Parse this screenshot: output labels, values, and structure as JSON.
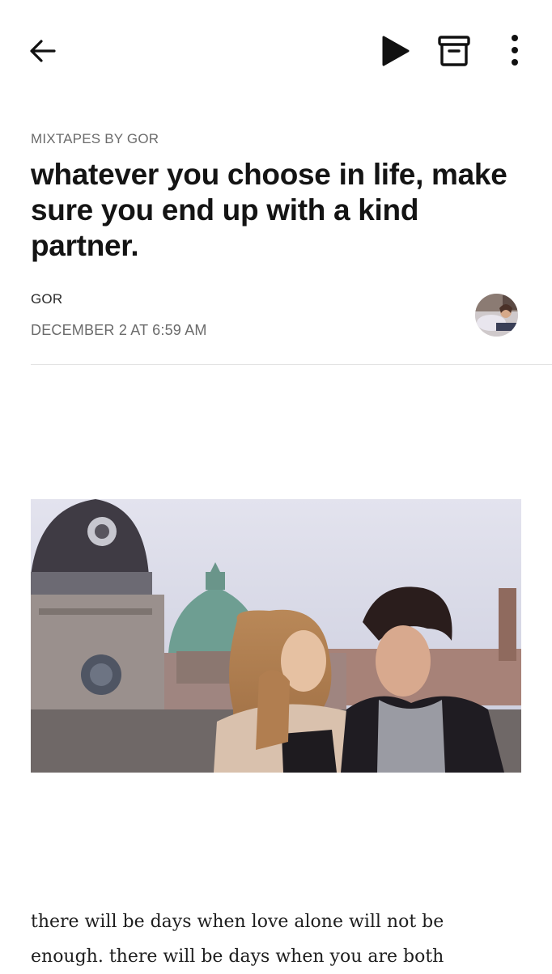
{
  "toolbar": {
    "back_icon": "arrow-left-icon",
    "play_icon": "play-icon",
    "archive_icon": "archive-icon",
    "more_icon": "more-vertical-icon"
  },
  "post": {
    "publication": "MIXTAPES BY GOR",
    "title": "whatever you choose in life, make sure you end up with a kind partner.",
    "author": "GOR",
    "date": "DECEMBER 2 AT 6:59 AM",
    "body_lines": [
      "there will be days when love alone will not be",
      "enough. there will be days when you are both"
    ]
  },
  "colors": {
    "text": "#141414",
    "muted": "#6b6b6b",
    "divider": "#e3e3e3",
    "background": "#ffffff"
  }
}
